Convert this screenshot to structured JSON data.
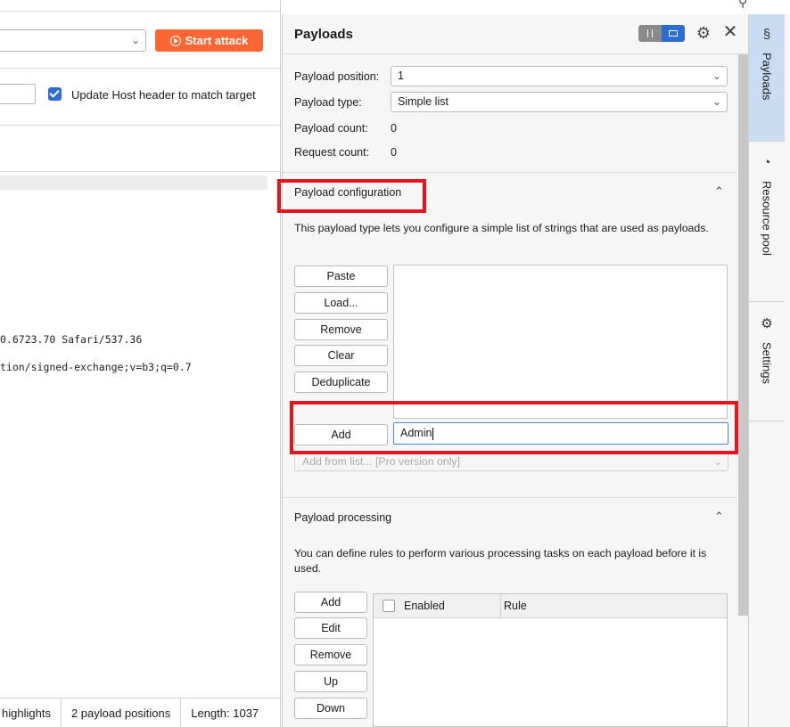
{
  "left": {
    "start_attack": "Start attack",
    "update_host_label": "Update Host header to match target",
    "code_lines": [
      "0.6723.70 Safari/537.36",
      "tion/signed-exchange;v=b3;q=0.7"
    ],
    "status": {
      "highlights": "highlights",
      "payload_positions": "2 payload positions",
      "length": "Length: 1037"
    }
  },
  "panel": {
    "title": "Payloads",
    "payload_position_label": "Payload position:",
    "payload_position_value": "1",
    "payload_type_label": "Payload type:",
    "payload_type_value": "Simple list",
    "payload_count_label": "Payload count:",
    "payload_count_value": "0",
    "request_count_label": "Request count:",
    "request_count_value": "0",
    "config": {
      "title": "Payload configuration",
      "description": "This payload type lets you configure a simple list of strings that are used as payloads.",
      "buttons": [
        "Paste",
        "Load...",
        "Remove",
        "Clear",
        "Deduplicate"
      ],
      "add_label": "Add",
      "add_value": "Admin",
      "add_from_list": "Add from list... [Pro version only]"
    },
    "processing": {
      "title": "Payload processing",
      "description": "You can define rules to perform various processing tasks on each payload before it is used.",
      "buttons": [
        "Add",
        "Edit",
        "Remove",
        "Up",
        "Down"
      ],
      "col_enabled": "Enabled",
      "col_rule": "Rule"
    }
  },
  "sidebar": {
    "tabs": [
      "Payloads",
      "Resource pool",
      "Settings"
    ]
  },
  "colors": {
    "accent": "#ff6633",
    "blue": "#2b6ecf",
    "annotation": "#e8141b"
  }
}
